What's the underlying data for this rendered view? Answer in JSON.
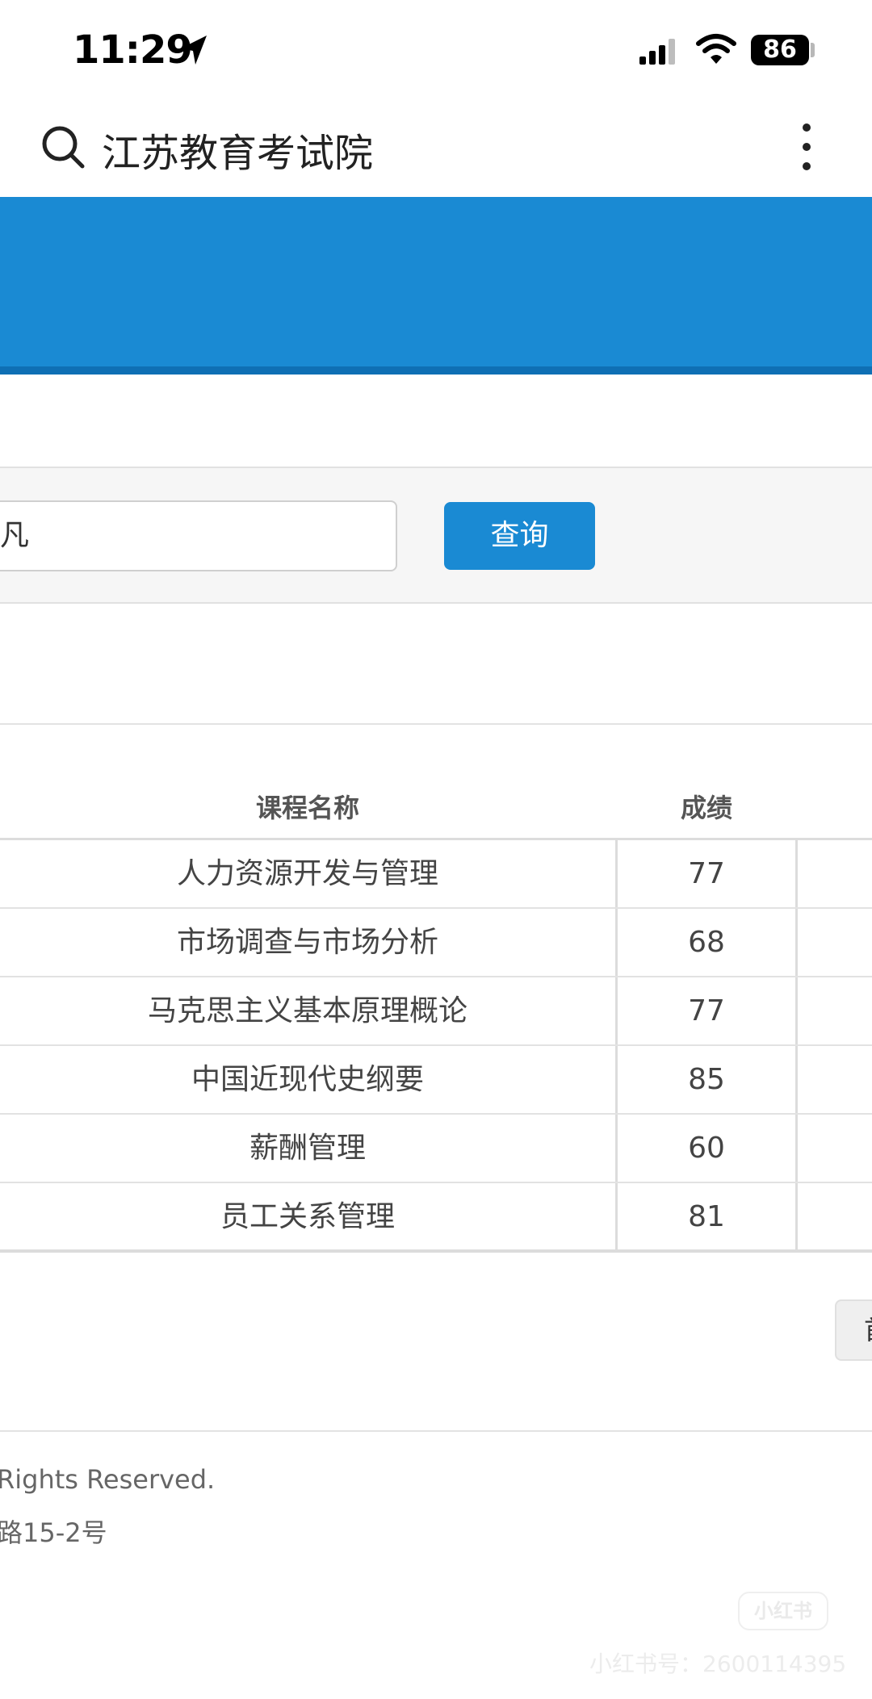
{
  "status_bar": {
    "time": "11:29",
    "battery": "86",
    "icons": [
      "location-arrow-icon",
      "cellular-signal-icon",
      "wifi-icon",
      "battery-icon"
    ]
  },
  "search_bar": {
    "query": "江苏教育考试院",
    "icons": [
      "search-icon",
      "more-vertical-icon"
    ]
  },
  "colors": {
    "banner": "#1a8ad3",
    "button": "#1a8ad3"
  },
  "query_form": {
    "name_value": "凡",
    "button_label": "查询"
  },
  "table": {
    "headers": [
      "课程名称",
      "成绩"
    ],
    "rows": [
      {
        "course": "人力资源开发与管理",
        "score": "77"
      },
      {
        "course": "市场调查与市场分析",
        "score": "68"
      },
      {
        "course": "马克思主义基本原理概论",
        "score": "77"
      },
      {
        "course": "中国近现代史纲要",
        "score": "85"
      },
      {
        "course": "薪酬管理",
        "score": "60"
      },
      {
        "course": "员工关系管理",
        "score": "81"
      }
    ]
  },
  "pager": {
    "first_label": "首"
  },
  "footer": {
    "line1": "Rights Reserved.",
    "line2": "路15-2号"
  },
  "watermark": {
    "logo": "小红书",
    "id": "小红书号：2600114395"
  }
}
